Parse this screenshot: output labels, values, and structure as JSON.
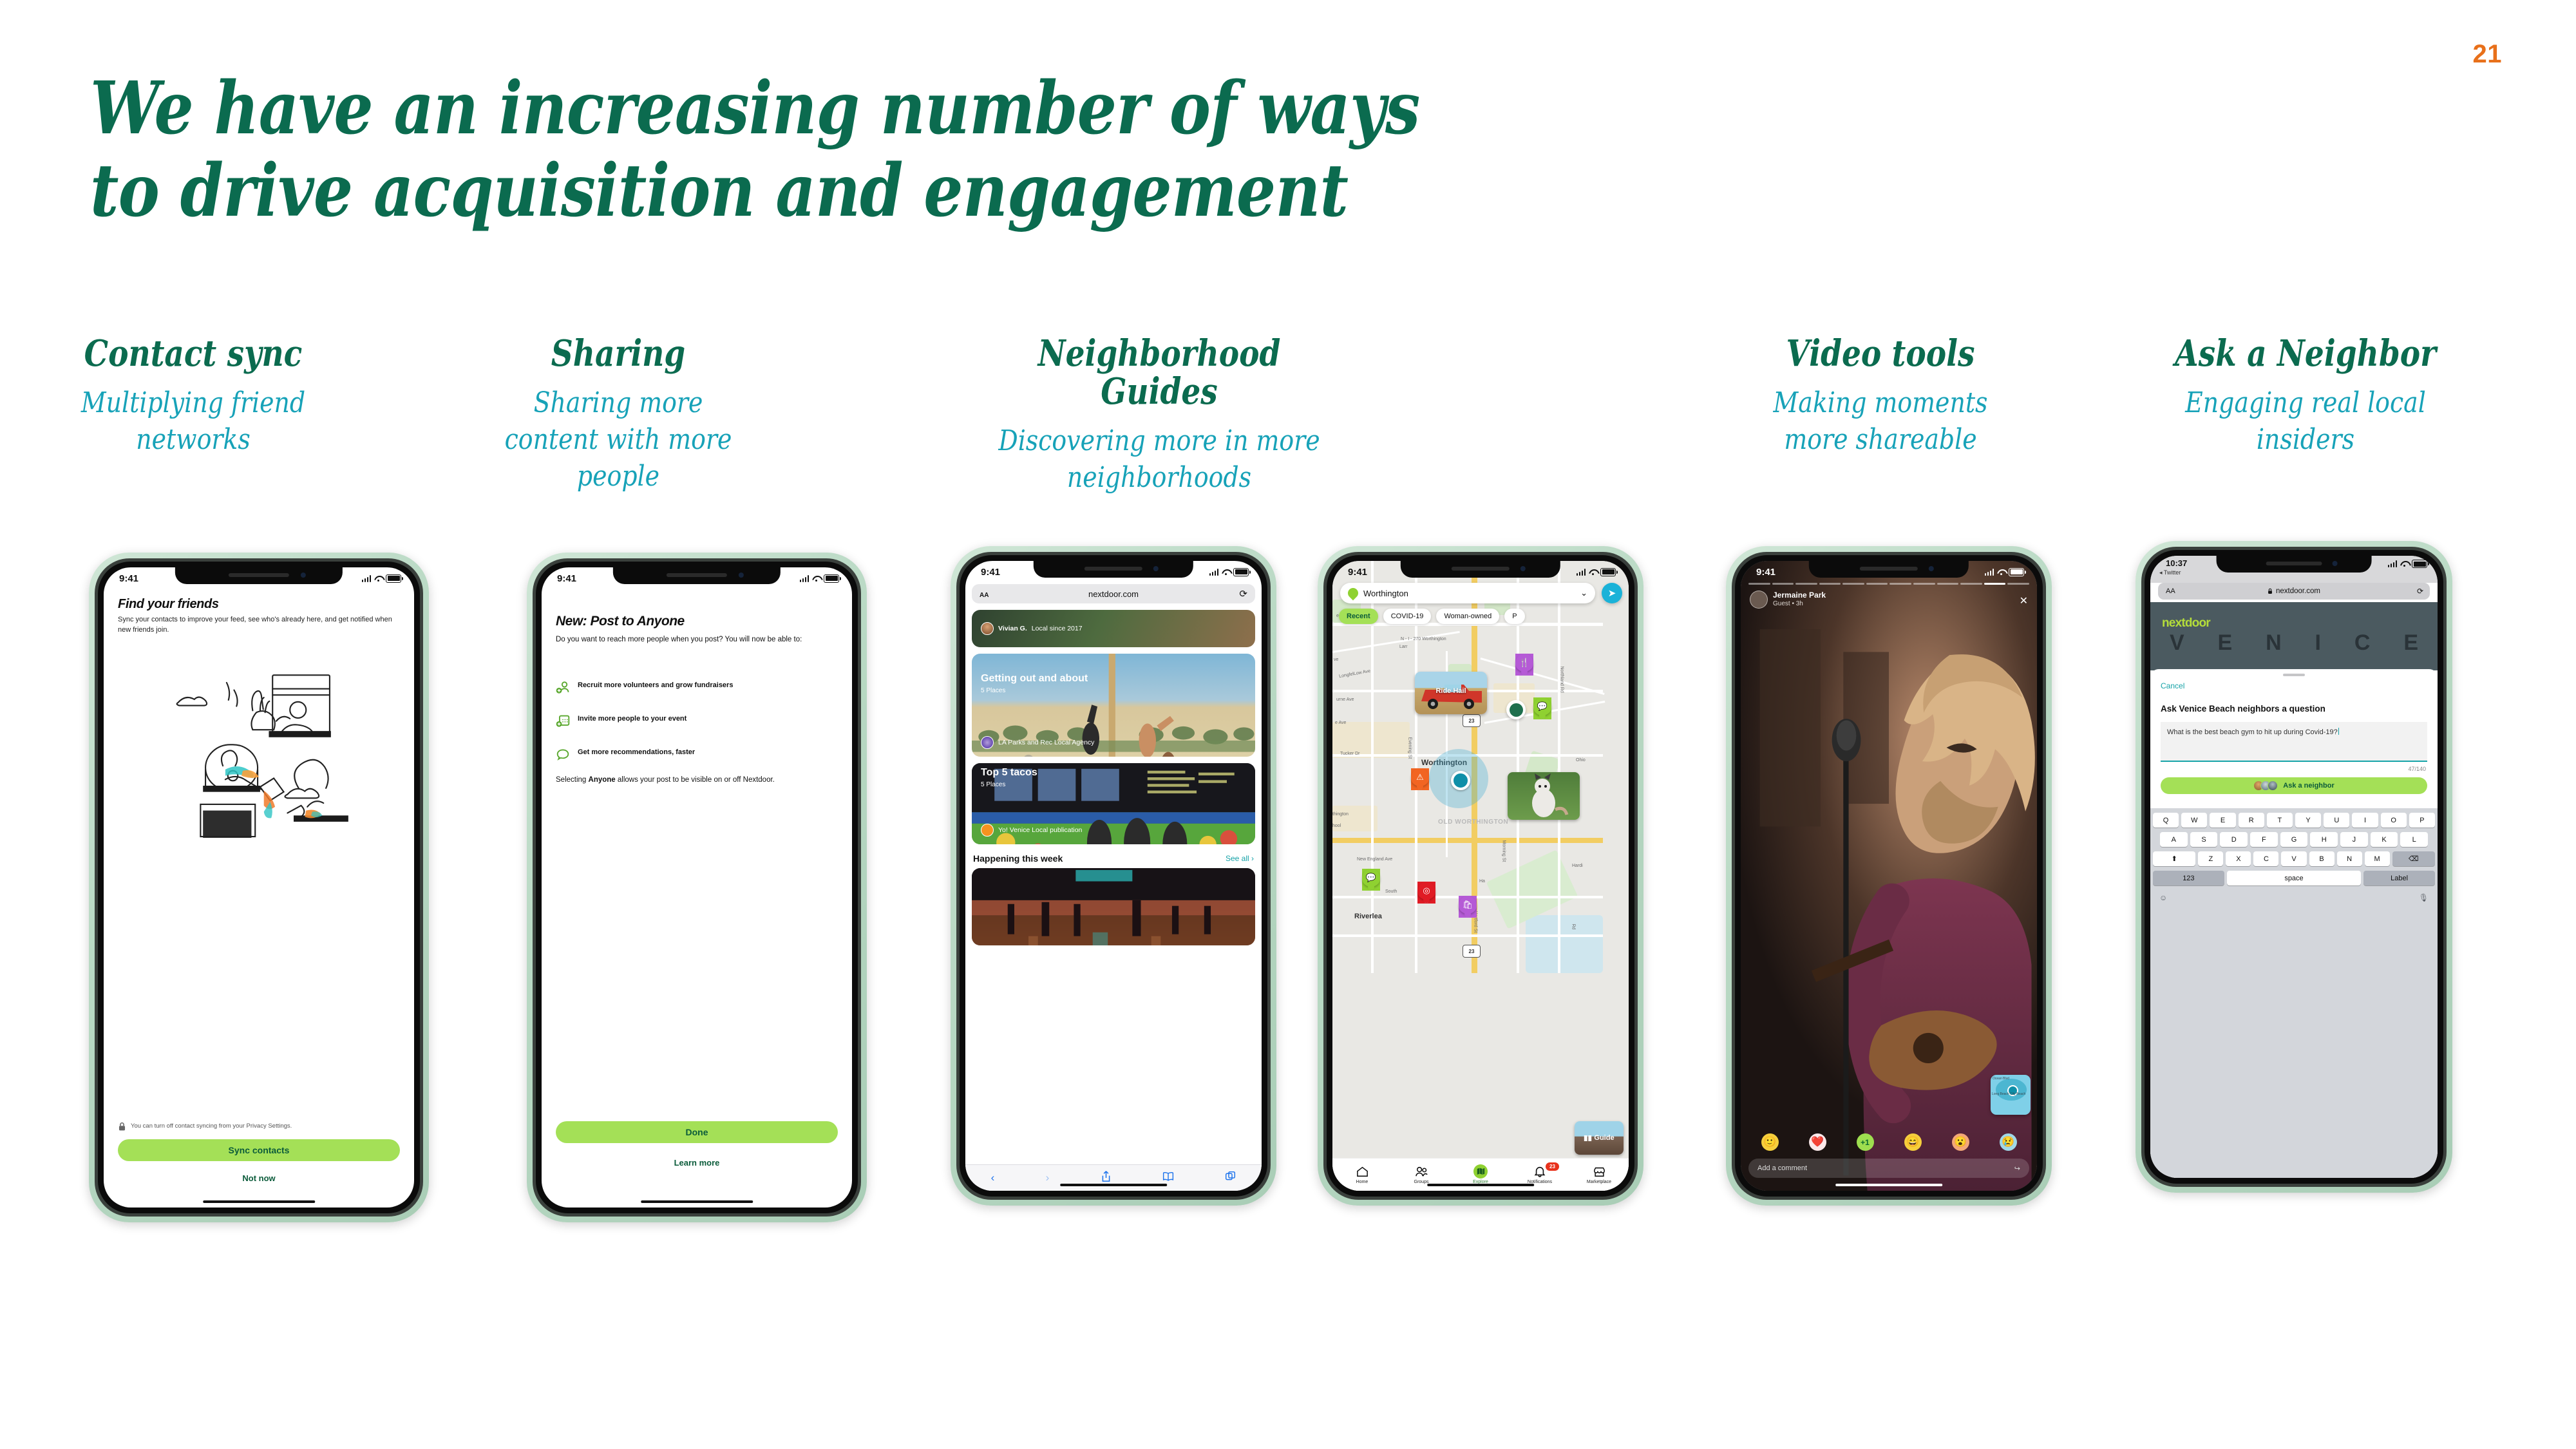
{
  "slide": {
    "page_number": "21",
    "title_line1": "We have an increasing number of ways",
    "title_line2": "to drive acquisition and engagement",
    "colors": {
      "title_green": "#0B6B4F",
      "subtitle_teal": "#17A2B8",
      "page_number_orange": "#E8701A",
      "nextdoor_green": "#A4E057",
      "dark_green": "#0B5B3A"
    }
  },
  "columns": [
    {
      "heading": "Contact sync",
      "subtitle": "Multiplying friend networks"
    },
    {
      "heading": "Sharing",
      "subtitle": "Sharing more content with more people"
    },
    {
      "heading": "Neighborhood Guides",
      "subtitle": "Discovering more in more neighborhoods"
    },
    {
      "heading": "Video tools",
      "subtitle": "Making moments more shareable"
    },
    {
      "heading": "Ask a Neighbor",
      "subtitle": "Engaging real local insiders"
    }
  ],
  "phone1": {
    "status_time": "9:41",
    "heading": "Find your friends",
    "body": "Sync your contacts to improve your feed, see who's already here, and get notified when new friends join.",
    "privacy_note": "You can turn off contact syncing from your Privacy Settings.",
    "primary_button": "Sync contacts",
    "secondary_link": "Not now"
  },
  "phone2": {
    "status_time": "9:41",
    "heading": "New: Post to Anyone",
    "body": "Do you want to reach more people when you post? You will now be able to:",
    "benefits": [
      {
        "icon": "add-person-icon",
        "text": "Recruit more volunteers and grow fundraisers"
      },
      {
        "icon": "add-calendar-icon",
        "text": "Invite more people to your event"
      },
      {
        "icon": "speech-bubble-icon",
        "text": "Get more recommendations, faster"
      }
    ],
    "footnote_pre": "Selecting ",
    "footnote_bold": "Anyone",
    "footnote_post": " allows your post to be visible on or off Nextdoor.",
    "primary_button": "Done",
    "secondary_link": "Learn more"
  },
  "phone3": {
    "status_time": "9:41",
    "browser_aa": "AA",
    "url": "nextdoor.com",
    "reload_icon": "reload-icon",
    "author_strip": {
      "name": "Vivian G.",
      "meta": "Local since 2017"
    },
    "cards": [
      {
        "title": "Getting out and about",
        "places": "5 Places",
        "source": "LA Parks and Rec Local Agency"
      },
      {
        "title": "Top 5 tacos",
        "places": "5 Places",
        "source": "Yo! Venice Local publication"
      }
    ],
    "section_title": "Happening this week",
    "see_all": "See all",
    "toolbar_icons": [
      "back-icon",
      "forward-icon",
      "share-icon",
      "bookmarks-icon",
      "tabs-icon"
    ]
  },
  "phone4": {
    "status_time": "9:41",
    "search_value": "Worthington",
    "chips": [
      "Recent",
      "COVID-19",
      "Woman-owned",
      "P"
    ],
    "map_labels": [
      "Larr",
      "LongfelLow Ave",
      "e Ave",
      "Tucker Dr",
      "Evening St",
      "Worthington",
      "OLD WORTHINGTON",
      "thington",
      "hool",
      "New England Ave",
      "South",
      "Riverlea",
      "Northland Rd",
      "Ohio",
      "Morning St",
      "Hartford St",
      "Hardi",
      "Ha",
      "Rd",
      "N - I - 270 Worthington",
      "urne Ave",
      "eenbriar",
      "ve",
      "23",
      "23"
    ],
    "map_card_labels": [
      "Ride Hail"
    ],
    "guide_chip": "Guide",
    "tabs": [
      {
        "label": "Home",
        "icon": "home-icon",
        "badge": ""
      },
      {
        "label": "Groups",
        "icon": "groups-icon",
        "badge": ""
      },
      {
        "label": "Explore",
        "icon": "explore-map-icon",
        "badge": ""
      },
      {
        "label": "Notifications",
        "icon": "bell-icon",
        "badge": "23"
      },
      {
        "label": "Marketplace",
        "icon": "storefront-icon",
        "badge": ""
      }
    ]
  },
  "phone5": {
    "status_time": "9:41",
    "author_name": "Jermaine Park",
    "author_meta": "Guest • 3h",
    "close_icon": "close-icon",
    "minimap_labels": [
      "Ocean Blvd",
      "Long Beach City Beach"
    ],
    "reactions": [
      "slightly-smiling-icon",
      "heart-icon",
      "plus-one-icon",
      "grinning-icon",
      "surprised-icon",
      "sad-tear-icon"
    ],
    "comment_placeholder": "Add a comment",
    "share_icon": "share-arrow-icon"
  },
  "phone6": {
    "status_time": "10:37",
    "back_app": "Twitter",
    "browser_aa": "AA",
    "url": "nextdoor.com",
    "lock_icon": "lock-icon",
    "brand": "nextdoor",
    "hero_word": "VENICE",
    "cancel": "Cancel",
    "sheet_title": "Ask Venice Beach neighbors a question",
    "question_value": "What is the best beach gym to hit up during Covid-19?",
    "char_counter": "47/140",
    "ask_button": "Ask a neighbor",
    "keyboard": {
      "row1": [
        "Q",
        "W",
        "E",
        "R",
        "T",
        "Y",
        "U",
        "I",
        "O",
        "P"
      ],
      "row2": [
        "A",
        "S",
        "D",
        "F",
        "G",
        "H",
        "J",
        "K",
        "L"
      ],
      "row3_shift": "shift-icon",
      "row3": [
        "Z",
        "X",
        "C",
        "V",
        "B",
        "N",
        "M"
      ],
      "row3_delete": "delete-icon",
      "numeric": "123",
      "space": "space",
      "return": "Label",
      "emoji": "emoji-icon",
      "mic": "mic-icon"
    }
  }
}
